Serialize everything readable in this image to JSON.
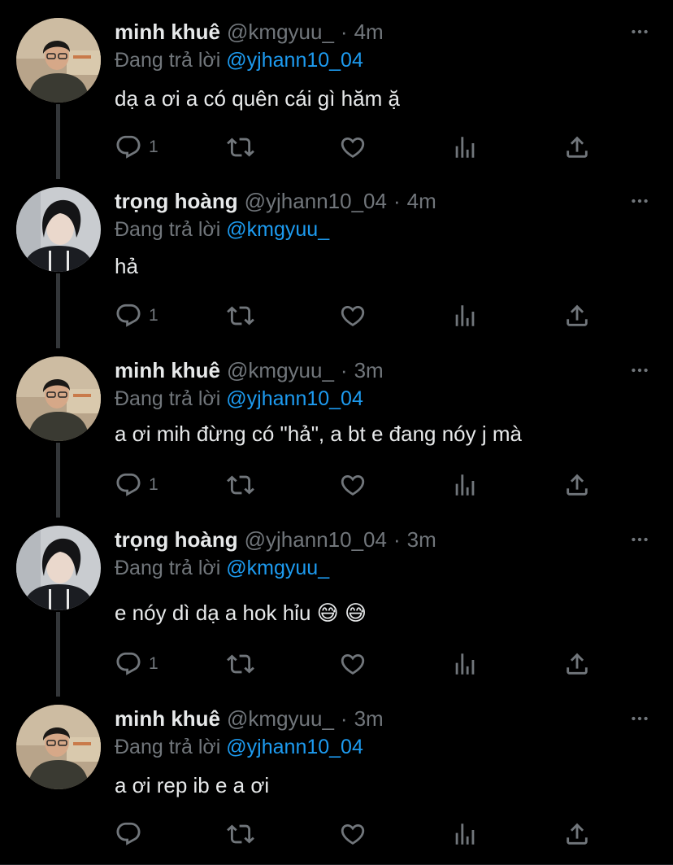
{
  "colors": {
    "background": "#000000",
    "text": "#e7e9ea",
    "muted": "#71767b",
    "accent": "#1d9bf0"
  },
  "tweets": [
    {
      "name": "minh khuê",
      "handle": "@kmgyuu_",
      "dot": "·",
      "time": "4m",
      "reply_prefix": "Đang trả lời",
      "reply_mention": "@yjhann10_04",
      "text": "dạ a ơi a có quên cái gì hăm ặ",
      "reply_count": "1",
      "avatar": "avatar-minh-khue"
    },
    {
      "name": "trọng hoàng",
      "handle": "@yjhann10_04",
      "dot": "·",
      "time": "4m",
      "reply_prefix": "Đang trả lời",
      "reply_mention": "@kmgyuu_",
      "text": "hả",
      "reply_count": "1",
      "avatar": "avatar-trong-hoang"
    },
    {
      "name": "minh khuê",
      "handle": "@kmgyuu_",
      "dot": "·",
      "time": "3m",
      "reply_prefix": "Đang trả lời",
      "reply_mention": "@yjhann10_04",
      "text": "a ơi mih đừng có \"hả\", a bt e đang nóy j mà",
      "reply_count": "1",
      "avatar": "avatar-minh-khue"
    },
    {
      "name": "trọng hoàng",
      "handle": "@yjhann10_04",
      "dot": "·",
      "time": "3m",
      "reply_prefix": "Đang trả lời",
      "reply_mention": "@kmgyuu_",
      "text": "e nóy dì dạ a hok hỉu 😅 😅",
      "reply_count": "1",
      "avatar": "avatar-trong-hoang"
    },
    {
      "name": "minh khuê",
      "handle": "@kmgyuu_",
      "dot": "·",
      "time": "3m",
      "reply_prefix": "Đang trả lời",
      "reply_mention": "@yjhann10_04",
      "text": "a ơi rep ib e a ơi",
      "reply_count": "",
      "avatar": "avatar-minh-khue"
    }
  ],
  "icons": [
    "reply-icon",
    "retweet-icon",
    "like-icon",
    "views-icon",
    "share-icon",
    "more-icon"
  ]
}
